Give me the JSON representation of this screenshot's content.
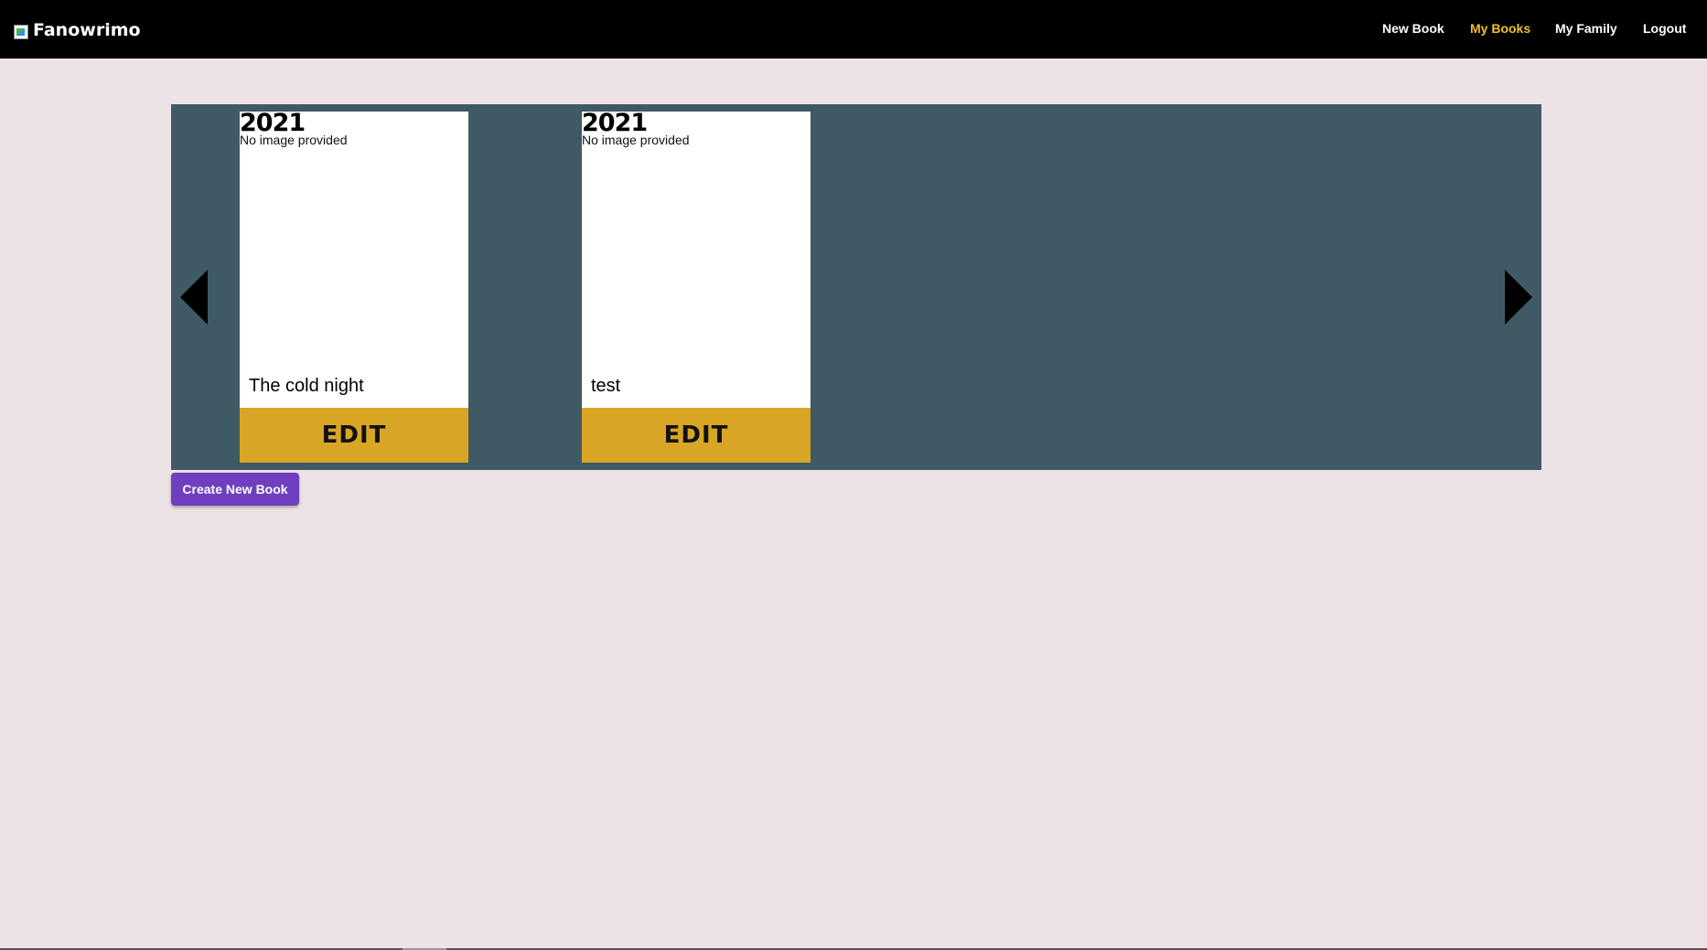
{
  "navbar": {
    "brand": "Fanowrimo",
    "links": [
      {
        "label": "New Book",
        "active": false
      },
      {
        "label": "My Books",
        "active": true
      },
      {
        "label": "My Family",
        "active": false
      },
      {
        "label": "Logout",
        "active": false
      }
    ]
  },
  "books": [
    {
      "year": "2021",
      "image_text": "No image provided",
      "title": "The cold night",
      "edit_label": "EDIT"
    },
    {
      "year": "2021",
      "image_text": "No image provided",
      "title": "test",
      "edit_label": "EDIT"
    }
  ],
  "actions": {
    "create_label": "Create New Book"
  },
  "colors": {
    "page_bg": "#ede3e7",
    "navbar_bg": "#000000",
    "active_link": "#f0c02c",
    "carousel_bg": "#405a65",
    "edit_button": "#d9a524",
    "create_button": "#6f3fbf"
  },
  "icons": {
    "brand_logo": "broken-image-icon",
    "prev": "triangle-left-icon",
    "next": "triangle-right-icon"
  }
}
